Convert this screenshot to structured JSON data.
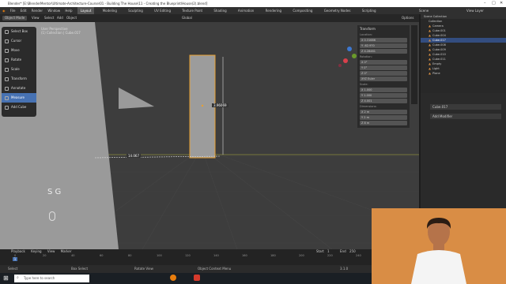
{
  "titlebar": {
    "text": "Blender* [E:\\BlenderMentor\\Ultimate-Architecture-Course\\01 - Building The House\\11 - Creating the Blueprint\\House(2).blend]"
  },
  "menubar": {
    "items": [
      "File",
      "Edit",
      "Render",
      "Window",
      "Help"
    ],
    "workspaces": [
      "Layout",
      "Modeling",
      "Sculpting",
      "UV Editing",
      "Texture Paint",
      "Shading",
      "Animation",
      "Rendering",
      "Compositing",
      "Geometry Nodes",
      "Scripting"
    ],
    "active_workspace": "Layout",
    "scene": "Scene",
    "view_layer": "View Layer"
  },
  "viewport_header": {
    "mode": "Object Mode",
    "menus": [
      "View",
      "Select",
      "Add",
      "Object"
    ],
    "transform": "Global",
    "overlay_label": "Options"
  },
  "viewport": {
    "info_line1": "User Perspective",
    "info_line2": "(1) Collection | Cube.017",
    "measure_height": "3.96069",
    "measure_width": "14.067",
    "gestures": "S  G"
  },
  "toolbar": {
    "tools": [
      "Select Box",
      "Cursor",
      "Move",
      "Rotate",
      "Scale",
      "Transform",
      "Annotate",
      "Measure",
      "Add Cube"
    ],
    "active_index": 7
  },
  "npanel": {
    "title": "Transform",
    "location_label": "Location:",
    "location": [
      "X  0.31686",
      "Y  -62.970",
      "Z  4.28461"
    ],
    "rotation_label": "Rotation:",
    "rotation": [
      "X  0°",
      "Y  0°",
      "Z  0°"
    ],
    "mode": "XYZ Euler",
    "scale_label": "Scale:",
    "scale": [
      "X  1.000",
      "Y  1.000",
      "Z  4.001"
    ],
    "dimensions_label": "Dimensions:",
    "dimensions": [
      "X  2 m",
      "Y  2 m",
      "Z  8 m"
    ]
  },
  "outliner": {
    "search": "Scene Collection",
    "items": [
      "Collection",
      "Camera",
      "Cube.001",
      "Cube.004",
      "Cube.017",
      "Cube.008",
      "Cube.009",
      "Cube.010",
      "Cube.011",
      "Empty",
      "Light",
      "Plane"
    ],
    "selected_index": 4
  },
  "properties": {
    "object_name": "Cube.017",
    "add_modifier": "Add Modifier"
  },
  "timeline": {
    "menus": [
      "Playback",
      "Keying",
      "View",
      "Marker"
    ],
    "frame_numbers": [
      "0",
      "20",
      "40",
      "60",
      "80",
      "100",
      "120",
      "140",
      "160",
      "180",
      "200",
      "220",
      "240"
    ],
    "start_label": "Start",
    "start": "1",
    "end_label": "End",
    "end": "250",
    "current": "1"
  },
  "statusbar": {
    "select": "Select",
    "box": "Box Select",
    "rotate": "Rotate View",
    "menu": "Object Context Menu",
    "version": "3.1.0"
  },
  "taskbar": {
    "search_placeholder": "Type here to search"
  },
  "colors": {
    "accent": "#4772b3",
    "selection": "#e8a030",
    "bg": "#3d3d3d"
  }
}
